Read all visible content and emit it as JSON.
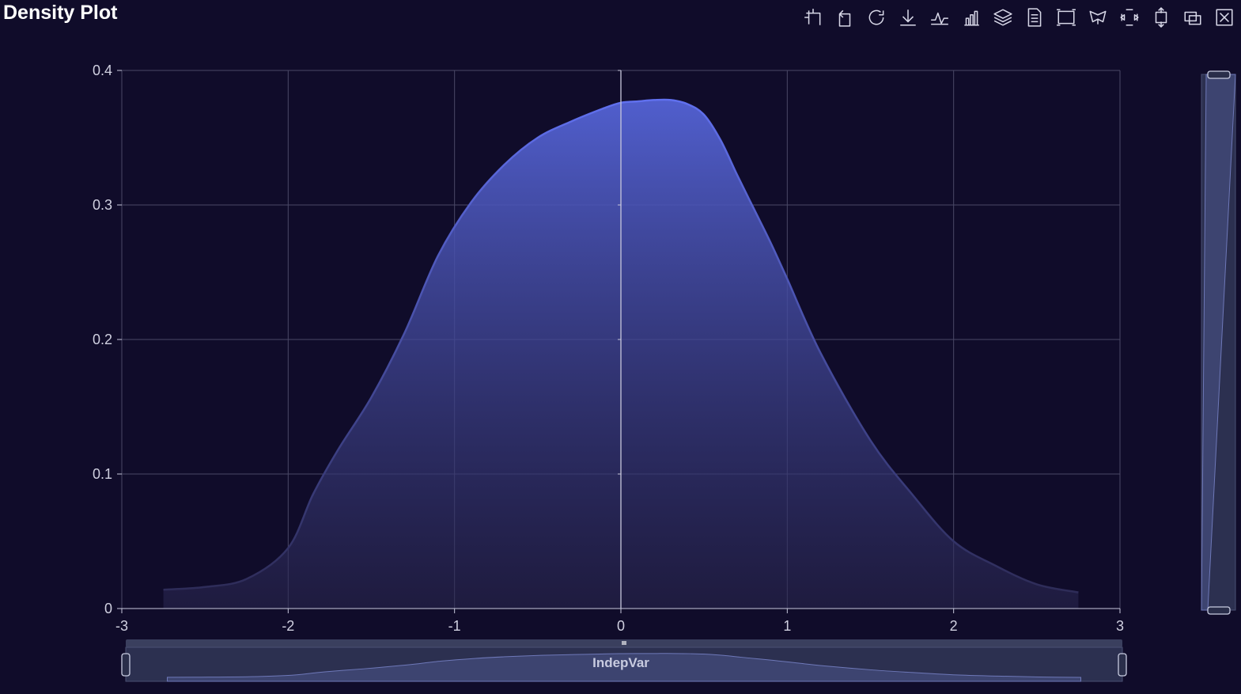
{
  "title": "Density Plot",
  "toolbox": [
    {
      "name": "zoom-icon"
    },
    {
      "name": "undo-icon"
    },
    {
      "name": "restore-icon"
    },
    {
      "name": "download-icon"
    },
    {
      "name": "line-chart-icon"
    },
    {
      "name": "bar-chart-icon"
    },
    {
      "name": "stack-icon"
    },
    {
      "name": "data-view-icon"
    },
    {
      "name": "rect-select-icon"
    },
    {
      "name": "lasso-select-icon"
    },
    {
      "name": "keep-select-icon"
    },
    {
      "name": "clear-select-icon"
    },
    {
      "name": "overlay-icon"
    },
    {
      "name": "clear-icon"
    }
  ],
  "colors": {
    "background": "#100c2a",
    "line": "#5b68e8",
    "grid": "#4a4866",
    "text": "#d0d0e0"
  },
  "chart_data": {
    "type": "area",
    "title": "Density Plot",
    "xlabel": "",
    "ylabel": "",
    "xlim": [
      -3,
      3
    ],
    "ylim": [
      0,
      0.4
    ],
    "xticks": [
      "-3",
      "-2",
      "-1",
      "0",
      "1",
      "2",
      "3"
    ],
    "yticks": [
      "0",
      "0.1",
      "0.2",
      "0.3",
      "0.4"
    ],
    "grid": true,
    "series": [
      {
        "x": [
          -2.75,
          -2.5,
          -2.25,
          -2.0,
          -1.85,
          -1.7,
          -1.5,
          -1.3,
          -1.1,
          -0.9,
          -0.7,
          -0.5,
          -0.3,
          -0.1,
          0.0,
          0.1,
          0.2,
          0.3,
          0.4,
          0.5,
          0.6,
          0.7,
          0.8,
          0.9,
          1.0,
          1.2,
          1.5,
          1.75,
          2.0,
          2.25,
          2.5,
          2.75
        ],
        "y": [
          0.014,
          0.016,
          0.022,
          0.045,
          0.085,
          0.118,
          0.157,
          0.205,
          0.262,
          0.302,
          0.33,
          0.35,
          0.362,
          0.372,
          0.376,
          0.377,
          0.378,
          0.378,
          0.375,
          0.367,
          0.348,
          0.322,
          0.297,
          0.272,
          0.245,
          0.19,
          0.125,
          0.085,
          0.05,
          0.032,
          0.018,
          0.012
        ]
      }
    ]
  },
  "slider": {
    "label": "IndepVar",
    "start": 0,
    "end": 100
  }
}
